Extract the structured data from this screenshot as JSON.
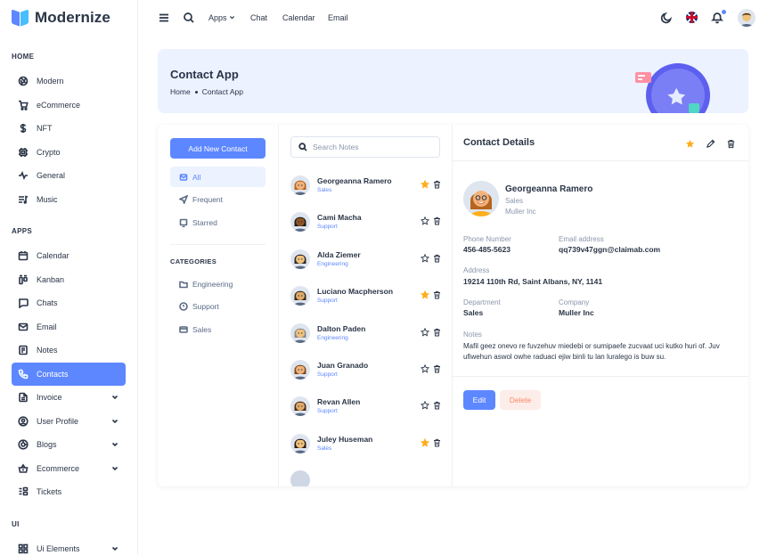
{
  "brand": {
    "name": "Modernize"
  },
  "sidebar": {
    "sections": {
      "home": "HOME",
      "apps": "APPS",
      "ui": "UI"
    },
    "home_items": [
      {
        "label": "Modern",
        "icon": "aperture-icon"
      },
      {
        "label": "eCommerce",
        "icon": "shopping-cart-icon"
      },
      {
        "label": "NFT",
        "icon": "currency-dollar-icon"
      },
      {
        "label": "Crypto",
        "icon": "cpu-icon"
      },
      {
        "label": "General",
        "icon": "activity-heartbeat-icon"
      },
      {
        "label": "Music",
        "icon": "playlist-icon"
      }
    ],
    "app_items": [
      {
        "label": "Calendar",
        "icon": "calendar-icon"
      },
      {
        "label": "Kanban",
        "icon": "layout-kanban-icon"
      },
      {
        "label": "Chats",
        "icon": "message-icon"
      },
      {
        "label": "Email",
        "icon": "mail-icon"
      },
      {
        "label": "Notes",
        "icon": "notes-icon"
      },
      {
        "label": "Contacts",
        "icon": "phone-icon",
        "active": true
      },
      {
        "label": "Invoice",
        "icon": "file-text-icon",
        "expandable": true
      },
      {
        "label": "User Profile",
        "icon": "user-circle-icon",
        "expandable": true
      },
      {
        "label": "Blogs",
        "icon": "chart-donut-icon",
        "expandable": true
      },
      {
        "label": "Ecommerce",
        "icon": "basket-icon",
        "expandable": true
      },
      {
        "label": "Tickets",
        "icon": "ticket-icon"
      }
    ],
    "ui_items": [
      {
        "label": "Ui Elements",
        "icon": "layout-grid-icon",
        "expandable": true
      }
    ]
  },
  "topbar": {
    "links": [
      "Apps",
      "Chat",
      "Calendar",
      "Email"
    ]
  },
  "banner": {
    "title": "Contact App",
    "breadcrumb": [
      "Home",
      "Contact App"
    ]
  },
  "filters": {
    "add_button": "Add New Contact",
    "items": [
      {
        "label": "All",
        "active": true
      },
      {
        "label": "Frequent"
      },
      {
        "label": "Starred"
      }
    ],
    "categories_heading": "CATEGORIES",
    "categories": [
      "Engineering",
      "Support",
      "Sales"
    ]
  },
  "search": {
    "placeholder": "Search Notes",
    "value": ""
  },
  "contacts": [
    {
      "name": "Georgeanna Ramero",
      "department": "Sales",
      "starred": true,
      "skin": "#f3b27a",
      "hair": "#b5651d"
    },
    {
      "name": "Cami Macha",
      "department": "Support",
      "starred": false,
      "skin": "#8d5524",
      "hair": "#1b1b1b"
    },
    {
      "name": "Alda Ziemer",
      "department": "Engineering",
      "starred": false,
      "skin": "#f1c27d",
      "hair": "#2a2a2a"
    },
    {
      "name": "Luciano Macpherson",
      "department": "Support",
      "starred": true,
      "skin": "#e0ac69",
      "hair": "#3b2a1a"
    },
    {
      "name": "Dalton Paden",
      "department": "Engineering",
      "starred": false,
      "skin": "#f1c27d",
      "hair": "#8a8a8a"
    },
    {
      "name": "Juan Granado",
      "department": "Support",
      "starred": false,
      "skin": "#f3b27a",
      "hair": "#7a4a1f"
    },
    {
      "name": "Revan Allen",
      "department": "Support",
      "starred": false,
      "skin": "#e0ac69",
      "hair": "#4a2c17"
    },
    {
      "name": "Juley Huseman",
      "department": "Sales",
      "starred": true,
      "skin": "#f1c27d",
      "hair": "#2b1a10"
    }
  ],
  "details": {
    "title": "Contact Details",
    "name": "Georgeanna Ramero",
    "department": "Sales",
    "company": "Muller Inc",
    "fields": {
      "phone_label": "Phone Number",
      "phone": "456-485-5623",
      "email_label": "Email address",
      "email": "qq739v47ggn@claimab.com",
      "address_label": "Address",
      "address": "19214 110th Rd, Saint Albans, NY, 1141",
      "department_label": "Department",
      "department": "Sales",
      "company_label": "Company",
      "company": "Muller Inc",
      "notes_label": "Notes",
      "notes": "Mafil geez onevo re fuvzehuv miedebi or sumipaefe zucvaat uci kutko huri of. Juv ufiwehun aswol owhe raduaci ejiw binli tu lan luralego is buw su."
    },
    "edit_button": "Edit",
    "delete_button": "Delete"
  },
  "colors": {
    "primary": "#5d87ff",
    "primary_light": "#ecf2ff",
    "star": "#ffae1f",
    "danger": "#fa896b",
    "danger_light": "#fdede8",
    "text": "#2a3547"
  }
}
